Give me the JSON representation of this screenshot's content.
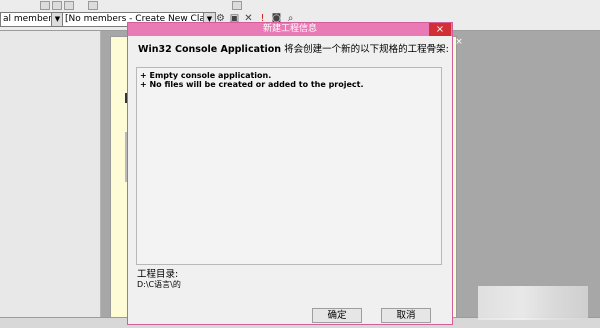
{
  "toolbar": {
    "combo1": "al members",
    "combo2": "[No members - Create New Class",
    "combo_arrow": "▼",
    "icons": [
      "build-icon",
      "copy-icon",
      "delete-icon",
      "run-icon",
      "breakpoint-icon",
      "search-icon"
    ]
  },
  "dialog": {
    "title": "新建工程信息",
    "close_label": "×",
    "headline_en": "Win32 Console Application",
    "headline_cn": " 将会创建一个新的以下规格的工程骨架:",
    "items": [
      "+ Empty console application.",
      "+ No files will be created or added to the project."
    ],
    "dir_label": "工程目录:",
    "dir_path": "D:\\C语言\\的",
    "ok_label": "确定",
    "cancel_label": "取消"
  },
  "colors": {
    "titlebar": "#ea7ab5",
    "close": "#d12e35",
    "editor": "#fefcd6"
  }
}
